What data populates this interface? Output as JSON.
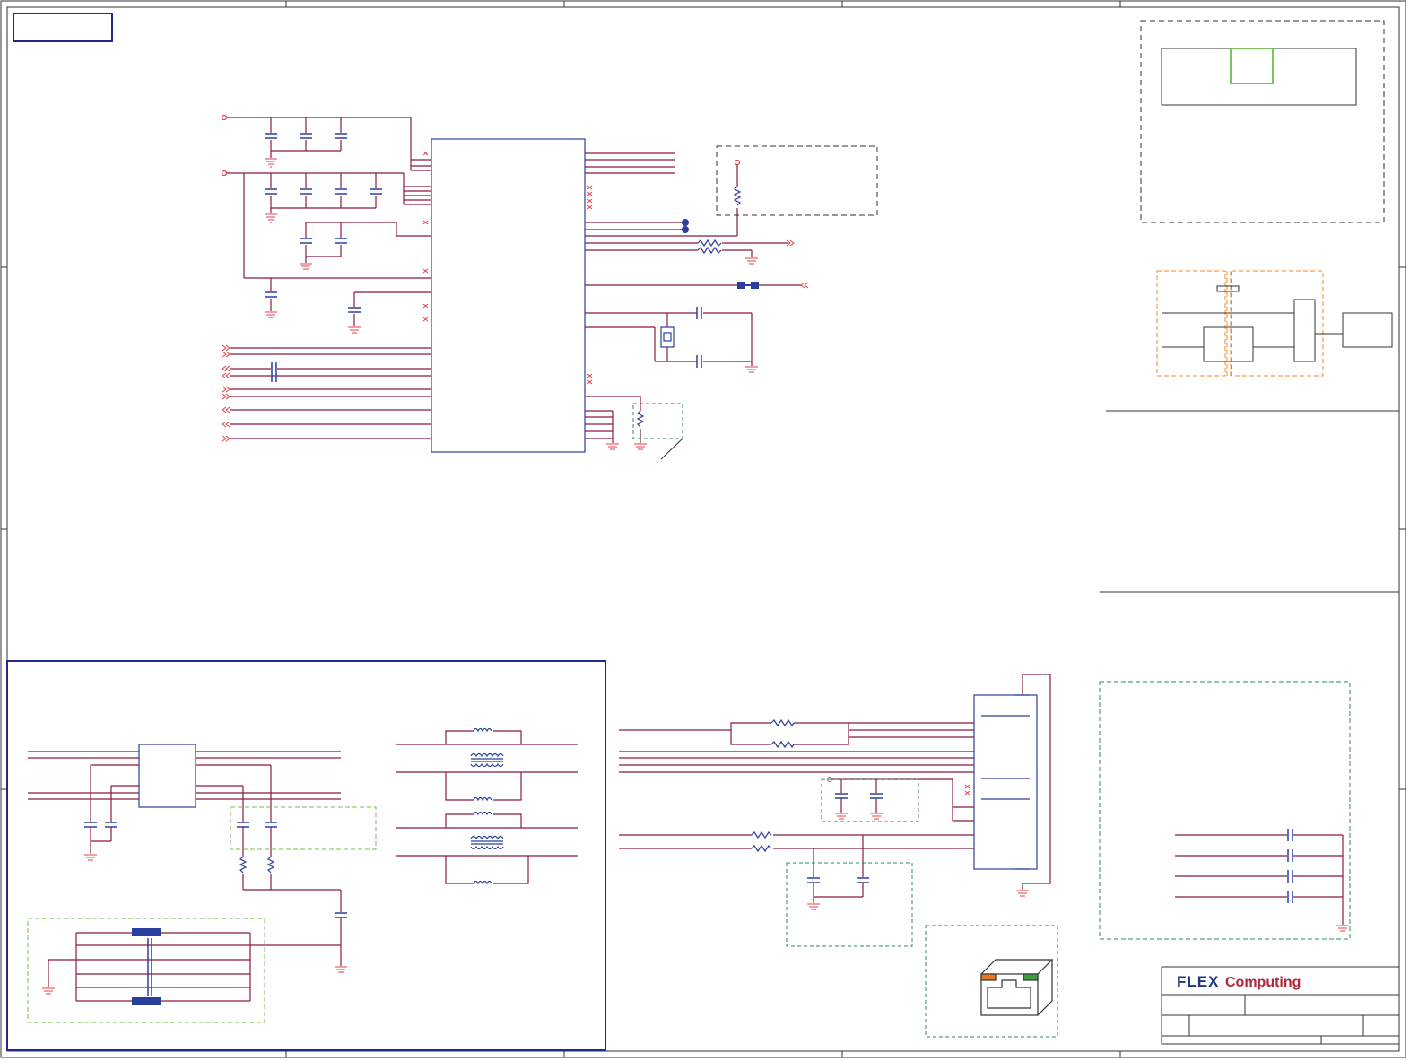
{
  "title_block": {
    "brand_flex": "FLEX",
    "brand_computing": "Computing"
  },
  "colors": {
    "wire": "#8b1a3c",
    "pin": "#e0404a",
    "part": "#2a3f9d",
    "border": "#1f2a8a",
    "frame": "#333333",
    "dashed_black": "#333333",
    "dashed_green": "#2e8b57",
    "dashed_lightgreen": "#6cc04a",
    "dashed_orange": "#f08a24",
    "led_orange": "#e87722",
    "led_green": "#3aa23a",
    "logo_blue": "#1f3a7a",
    "logo_red": "#b0283a"
  },
  "icons": [
    "capacitor-icon",
    "resistor-icon",
    "ground-icon",
    "crystal-icon",
    "transformer-icon",
    "ferrite-bead-icon",
    "rj45-jack-icon",
    "no-connect-icon",
    "offpage-connector-icon"
  ]
}
